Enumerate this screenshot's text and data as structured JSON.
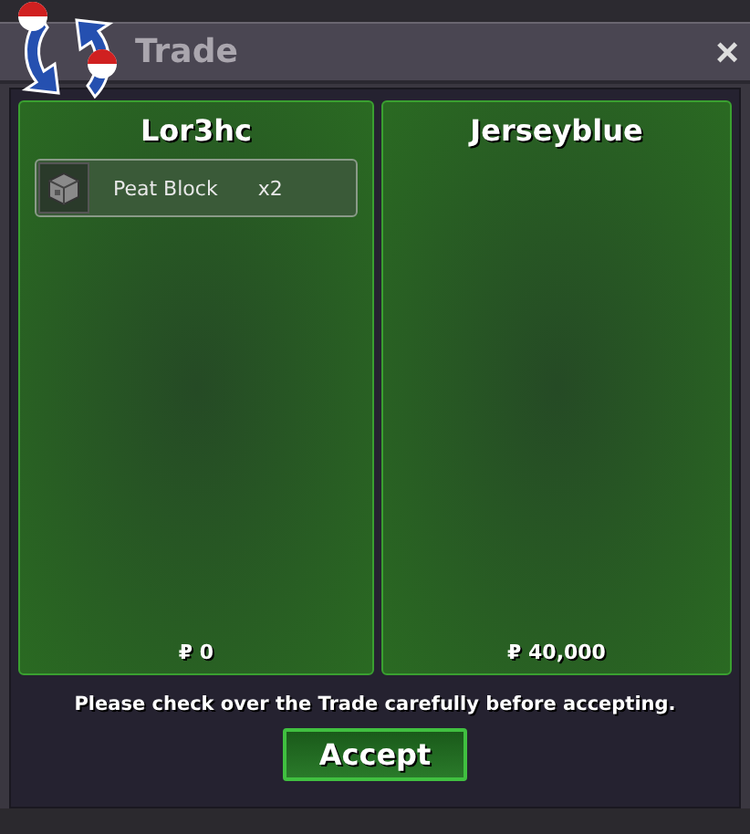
{
  "window": {
    "title": "Trade",
    "close": "×"
  },
  "panels": [
    {
      "name": "Lor3hc",
      "items": [
        {
          "name": "Peat Block",
          "quantity": "x2"
        }
      ],
      "money": "₽ 0"
    },
    {
      "name": "Jerseyblue",
      "money": "₽ 40,000"
    }
  ],
  "message": "Please check over the Trade carefully before accepting.",
  "buttons": [
    "Accept"
  ]
}
